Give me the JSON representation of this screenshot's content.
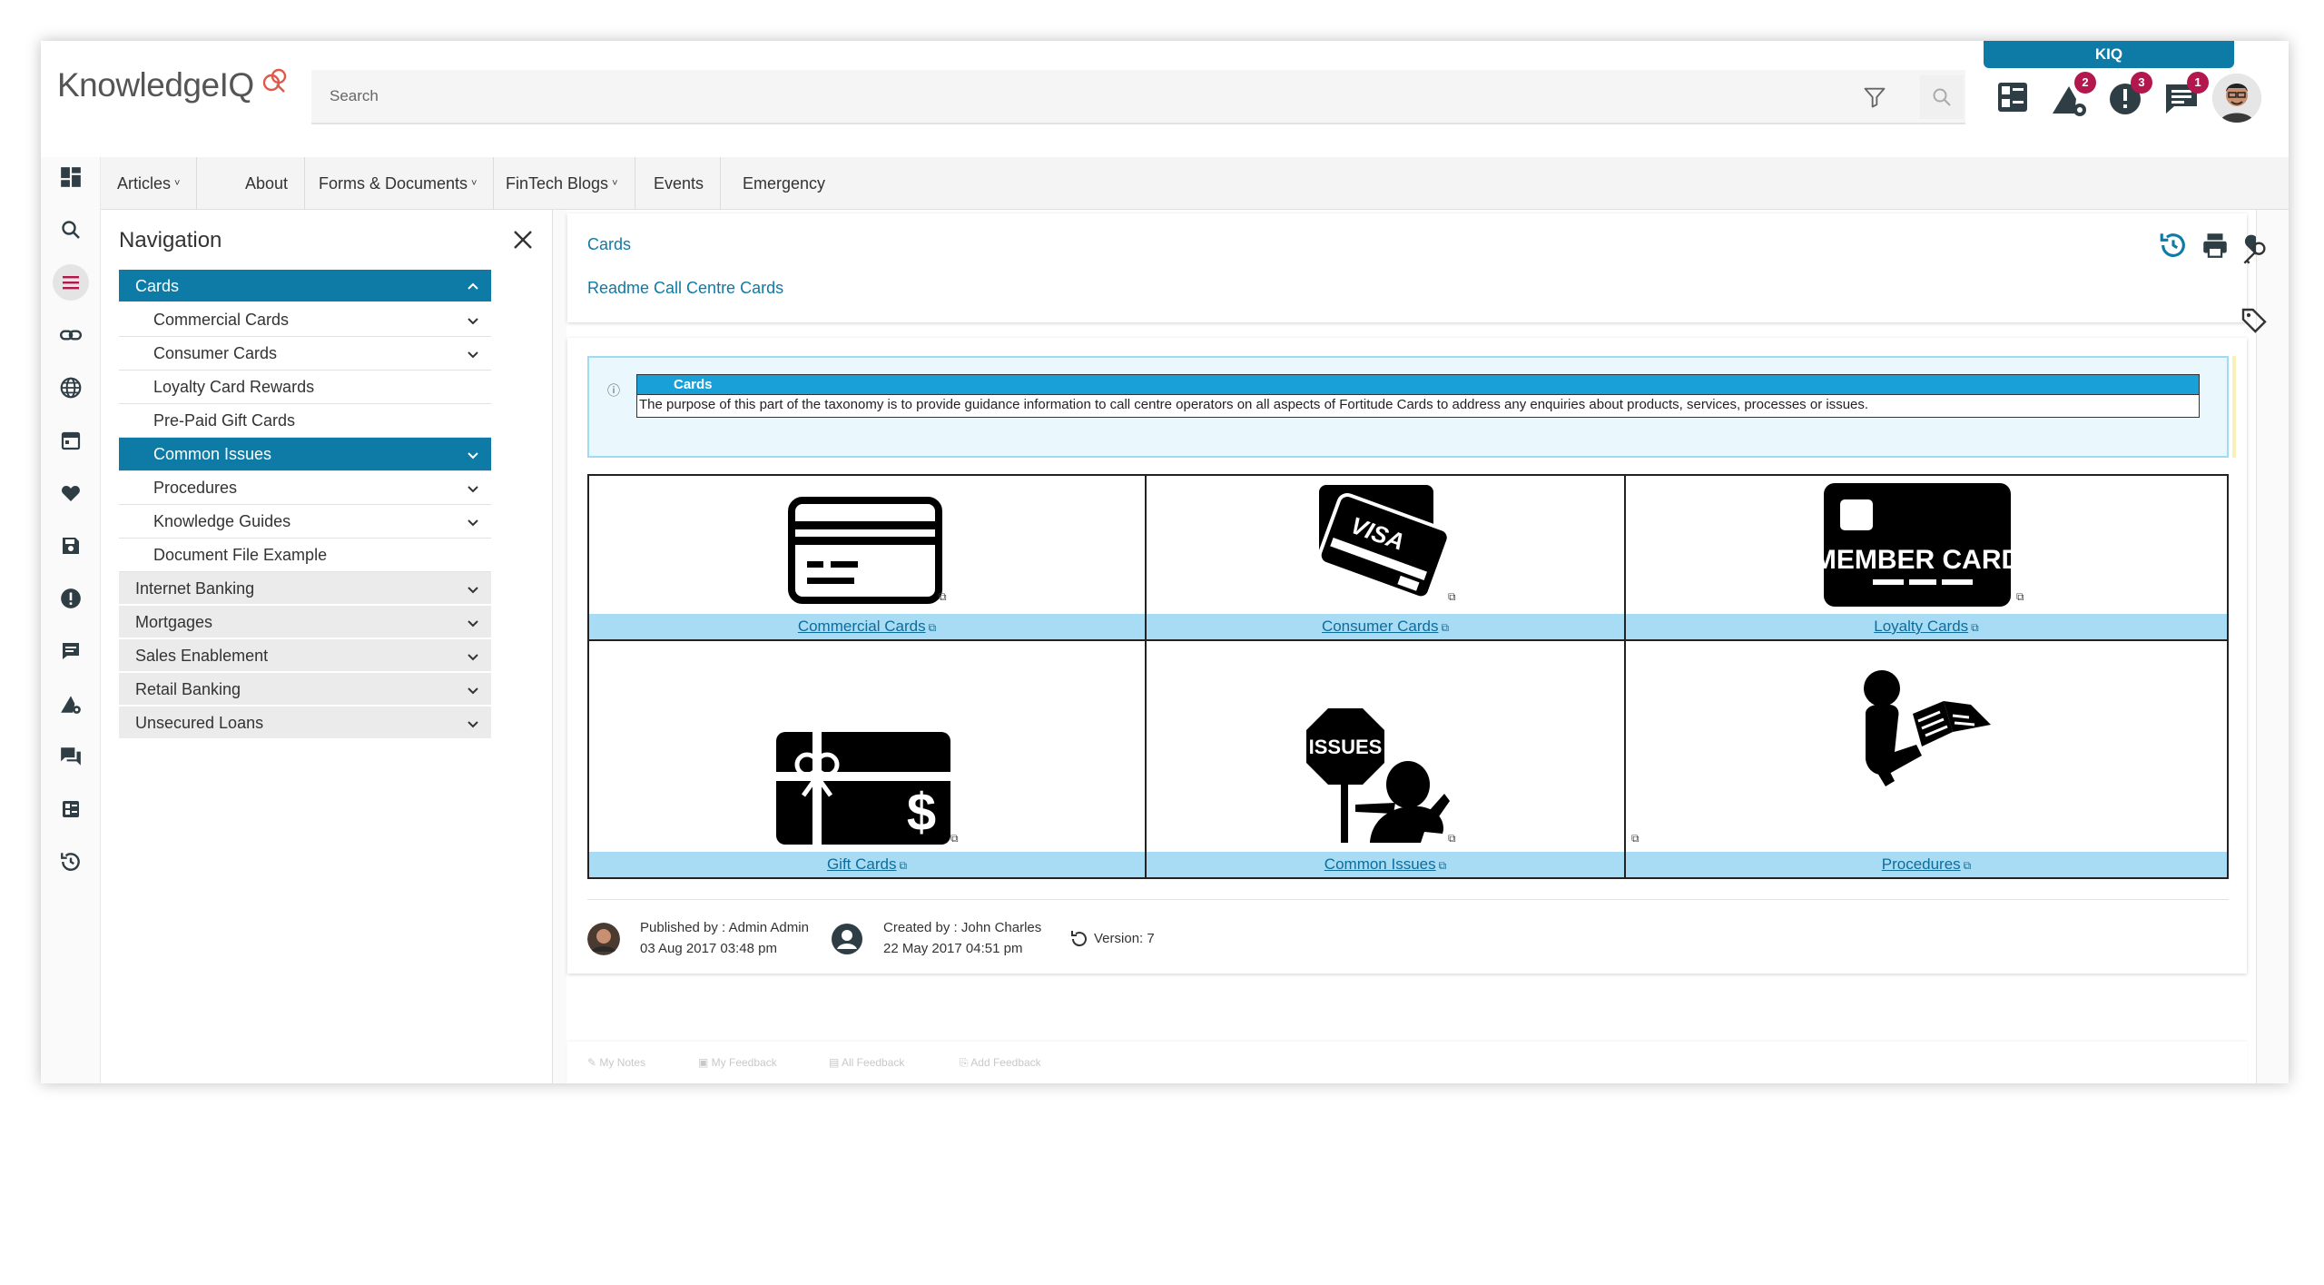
{
  "app": {
    "logo_text": "KnowledgeIQ",
    "search_placeholder": "Search",
    "kiq_tab": "KIQ",
    "badges": {
      "notifications": "2",
      "alerts": "3",
      "messages": "1"
    }
  },
  "menu": [
    {
      "label": "Articles",
      "caret": "˅"
    },
    {
      "label": "About",
      "caret": ""
    },
    {
      "label": "Forms & Documents",
      "caret": "˅"
    },
    {
      "label": "FinTech Blogs",
      "caret": "˅"
    },
    {
      "label": "Events",
      "caret": ""
    },
    {
      "label": "Emergency",
      "caret": ""
    }
  ],
  "navigation": {
    "title": "Navigation",
    "items": [
      {
        "label": "Cards",
        "level": 0,
        "state": "active-open"
      },
      {
        "label": "Commercial Cards",
        "level": 1,
        "state": "collapsed"
      },
      {
        "label": "Consumer Cards",
        "level": 1,
        "state": "collapsed"
      },
      {
        "label": "Loyalty Card Rewards",
        "level": 1,
        "state": "leaf"
      },
      {
        "label": "Pre-Paid Gift Cards",
        "level": 1,
        "state": "leaf"
      },
      {
        "label": "Common Issues",
        "level": 1,
        "state": "active-collapsed"
      },
      {
        "label": "Procedures",
        "level": 1,
        "state": "collapsed"
      },
      {
        "label": "Knowledge Guides",
        "level": 1,
        "state": "collapsed"
      },
      {
        "label": "Document File Example",
        "level": 1,
        "state": "leaf"
      },
      {
        "label": "Internet Banking",
        "level": 0,
        "state": "collapsed"
      },
      {
        "label": "Mortgages",
        "level": 0,
        "state": "collapsed"
      },
      {
        "label": "Sales Enablement",
        "level": 0,
        "state": "collapsed"
      },
      {
        "label": "Retail Banking",
        "level": 0,
        "state": "collapsed"
      },
      {
        "label": "Unsecured Loans",
        "level": 0,
        "state": "collapsed"
      }
    ]
  },
  "breadcrumb": {
    "section": "Cards",
    "article": "Readme Call Centre Cards"
  },
  "info": {
    "heading": "Cards",
    "text": "The purpose of this part of the taxonomy is to provide guidance information to call centre operators on all aspects of Fortitude Cards to address any enquiries about products, services,  processes or issues."
  },
  "tiles": [
    {
      "label": "Commercial Cards",
      "icon": "credit-card-outline-icon"
    },
    {
      "label": "Consumer Cards",
      "icon": "visa-card-icon",
      "card_text": "VISA"
    },
    {
      "label": "Loyalty Cards",
      "icon": "member-card-icon",
      "card_text": "MEMBER CARD"
    },
    {
      "label": "Gift Cards",
      "icon": "gift-card-icon",
      "card_text": "$"
    },
    {
      "label": "Common Issues",
      "icon": "issues-sign-icon",
      "card_text": "ISSUES"
    },
    {
      "label": "Procedures",
      "icon": "person-reading-icon"
    }
  ],
  "meta": {
    "published_by": "Published by : Admin Admin",
    "published_date": "03 Aug 2017 03:48 pm",
    "created_by": "Created by : John Charles",
    "created_date": "22 May 2017 04:51 pm",
    "version": "Version: 7"
  },
  "feedback": [
    {
      "label": "My Notes",
      "icon": "pencil-icon"
    },
    {
      "label": "My Feedback",
      "icon": "feedback-icon"
    },
    {
      "label": "All Feedback",
      "icon": "feedback-list-icon"
    },
    {
      "label": "Add Feedback",
      "icon": "add-document-icon"
    }
  ],
  "colors": {
    "accent": "#0e7aa6",
    "badge": "#b3174d",
    "caption_bg": "#a8dcf4",
    "info_bg": "#eaf8fd"
  }
}
